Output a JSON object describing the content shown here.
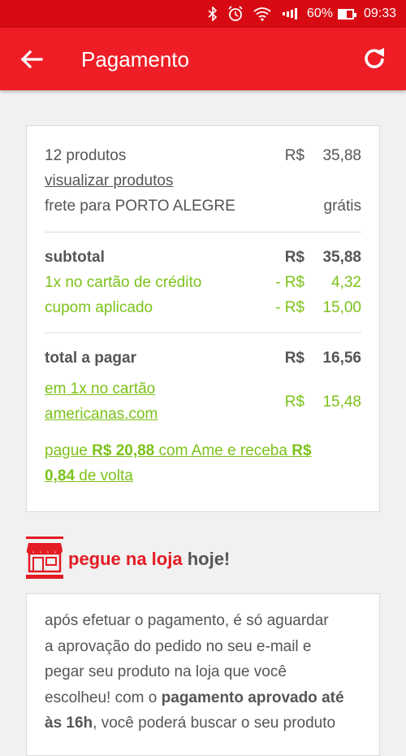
{
  "status_bar": {
    "battery_percent": "60%",
    "time": "09:33",
    "icons": [
      "bluetooth-icon",
      "alarm-icon",
      "wifi-icon",
      "signal-icon",
      "battery-icon"
    ]
  },
  "header": {
    "title": "Pagamento",
    "back_icon": "arrow-left-icon",
    "refresh_icon": "refresh-icon",
    "bg_color": "#ee1d26"
  },
  "summary": {
    "products_label": "12 produtos",
    "products_currency": "R$",
    "products_amount": "35,88",
    "view_products_link": "visualizar produtos",
    "shipping_label": "frete para PORTO ALEGRE",
    "shipping_value": "grátis",
    "subtotal_label": "subtotal",
    "subtotal_currency": "R$",
    "subtotal_amount": "35,88",
    "card_discount_label": "1x no cartão de crédito",
    "card_discount_currency": "- R$",
    "card_discount_amount": "4,32",
    "coupon_label": "cupom aplicado",
    "coupon_currency": "- R$",
    "coupon_amount": "15,00",
    "total_label": "total a pagar",
    "total_currency": "R$",
    "total_amount": "16,56",
    "installment_line1": "em 1x no cartão",
    "installment_line2": "americanas.com",
    "installment_currency": "R$",
    "installment_amount": "15,48",
    "ame_line1_a": "pague ",
    "ame_line1_b": "R$ 20,88",
    "ame_line1_c": " com Ame e receba ",
    "ame_line1_d": "R$",
    "ame_line2_a": "0,84",
    "ame_line2_b": " de volta",
    "accent_green": "#7cc21a"
  },
  "pickup": {
    "icon": "store-icon",
    "title_highlight": "pegue na loja",
    "title_rest": " hoje!",
    "title_color": "#e31b23"
  },
  "pickup_info": {
    "line1": "após efetuar o pagamento, é só aguardar",
    "line2": "a aprovação do pedido no seu e-mail e",
    "line3": "pegar seu produto na loja que você",
    "line4_a": "escolheu! com o ",
    "line4_b": "pagamento aprovado até",
    "line5_a": "às 16h",
    "line5_b": ", você poderá buscar o seu produto"
  }
}
